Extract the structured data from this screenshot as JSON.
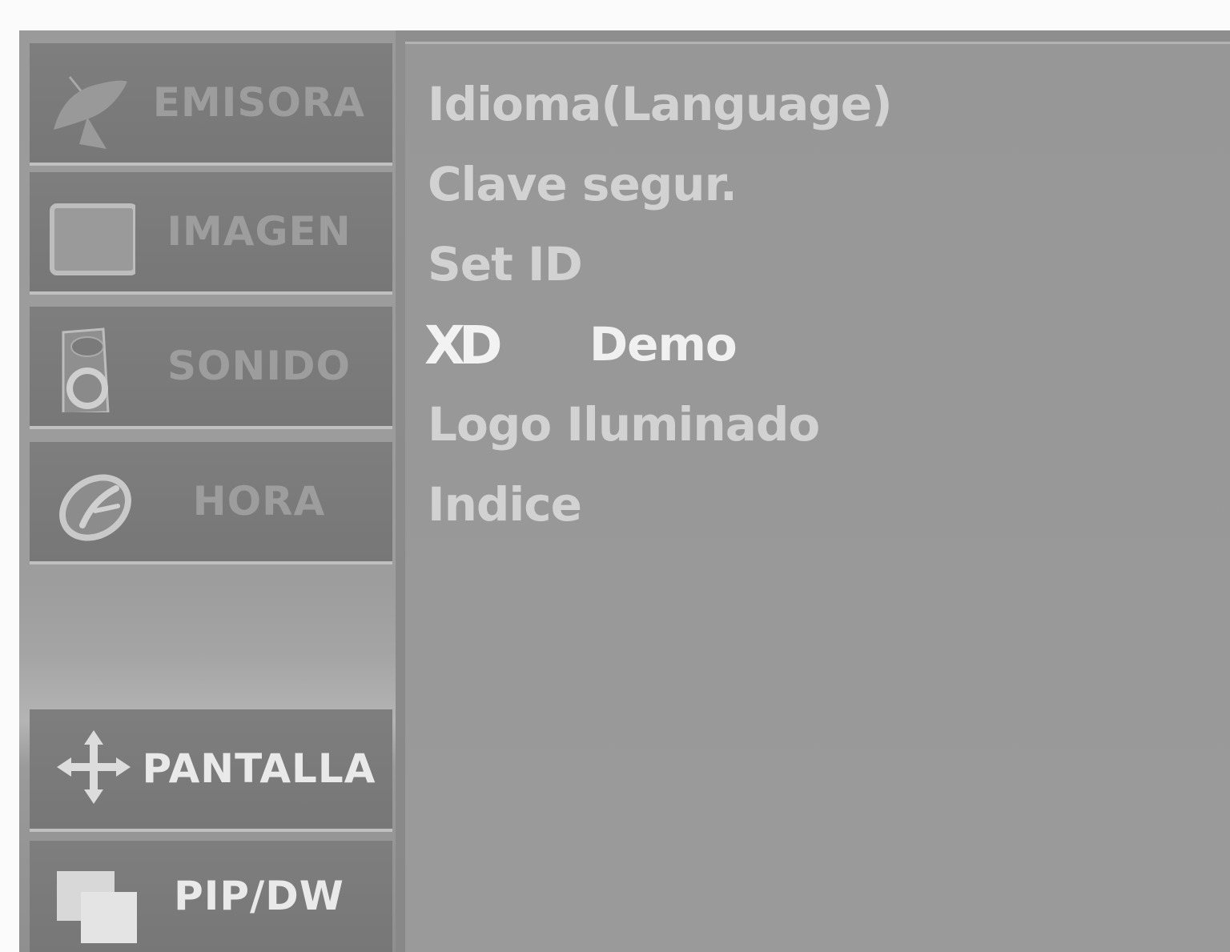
{
  "sidebar": {
    "items": [
      {
        "label": "EMISORA",
        "icon": "satellite-dish-icon"
      },
      {
        "label": "IMAGEN",
        "icon": "tv-screen-icon"
      },
      {
        "label": "SONIDO",
        "icon": "speaker-icon"
      },
      {
        "label": "HORA",
        "icon": "clock-icon"
      },
      {
        "label": "PANTALLA",
        "icon": "move-arrows-icon"
      },
      {
        "label": "PIP/DW",
        "icon": "overlapping-windows-icon"
      }
    ]
  },
  "options": {
    "items": [
      {
        "label": "Idioma(Language)"
      },
      {
        "label": "Clave segur."
      },
      {
        "label": "Set ID"
      },
      {
        "label": "Demo",
        "logo": "XD"
      },
      {
        "label": "Logo Iluminado"
      },
      {
        "label": "Indice"
      }
    ]
  }
}
